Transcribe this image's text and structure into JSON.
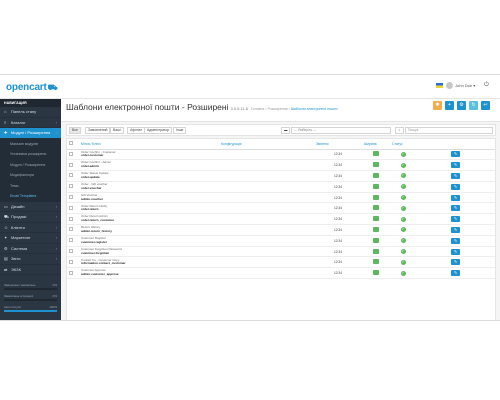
{
  "brand": {
    "logo_text": "opencart",
    "cart_glyph": "⛟"
  },
  "topbar": {
    "user_name": "John Doe",
    "user_menu_glyph": "▾",
    "logout_glyph": "⏻"
  },
  "sidebar": {
    "header": "НАВИГАЦИЯ",
    "items": [
      {
        "label": "Панель стану",
        "icon": "dashboard-icon",
        "glyph": "⌂",
        "arrow": ""
      },
      {
        "label": "Каталог",
        "icon": "catalog-icon",
        "glyph": "≡",
        "arrow": "›"
      },
      {
        "label": "Модулі / Розширення",
        "icon": "extension-icon",
        "glyph": "✚",
        "arrow": "›",
        "active": true
      }
    ],
    "subitems": [
      {
        "label": "Магазин модулів",
        "arrow": ""
      },
      {
        "label": "Установка розширень",
        "arrow": ""
      },
      {
        "label": "Модулі / Розширення",
        "arrow": ""
      },
      {
        "label": "Модифікатори",
        "arrow": ""
      },
      {
        "label": "Теми",
        "arrow": ""
      },
      {
        "label": "Email Templates",
        "arrow": "",
        "active": true
      }
    ],
    "items2": [
      {
        "label": "Дизайн",
        "icon": "design-icon",
        "glyph": "▭",
        "arrow": "›"
      },
      {
        "label": "Продажі",
        "icon": "sales-icon",
        "glyph": "⛟",
        "arrow": "›"
      },
      {
        "label": "Клієнти",
        "icon": "customers-icon",
        "glyph": "☺",
        "arrow": "›"
      },
      {
        "label": "Маркетинг",
        "icon": "marketing-icon",
        "glyph": "✦",
        "arrow": "›"
      },
      {
        "label": "Система",
        "icon": "system-icon",
        "glyph": "⚙",
        "arrow": "›"
      },
      {
        "label": "Звіти",
        "icon": "reports-icon",
        "glyph": "▤",
        "arrow": "›"
      },
      {
        "label": "ЭКЗК",
        "icon": "exchange-icon",
        "glyph": "⇄",
        "arrow": ""
      }
    ],
    "stats": [
      {
        "label": "Завершено замовлень",
        "value": "0%",
        "fill": 0.0
      },
      {
        "label": "Замовлень в процесі",
        "value": "0%",
        "fill": 0.0
      },
      {
        "label": "Інші статуси",
        "value": "100%",
        "fill": 1.0
      }
    ]
  },
  "header": {
    "title": "Шаблони електронної пошти - Розширені",
    "version": "3.0.5.11.6",
    "breadcrumb": [
      "Головна",
      "Розширення"
    ],
    "breadcrumb_current": "Шаблони електронної пошти",
    "buttons": [
      {
        "name": "lightbulb",
        "glyph": "✱",
        "color": "#f0ad4e"
      },
      {
        "name": "add",
        "glyph": "+",
        "color": "#1e91cf"
      },
      {
        "name": "settings",
        "glyph": "⚙",
        "color": "#1e91cf"
      },
      {
        "name": "refresh",
        "glyph": "↻",
        "color": "#5bc0de"
      },
      {
        "name": "back",
        "glyph": "↩",
        "color": "#1e91cf"
      }
    ]
  },
  "filters": {
    "groups": [
      "Все",
      "Замовлений",
      "Ваші",
      "Афіліат",
      "Адміністратор",
      "Інше"
    ],
    "select_placeholder": "--- Виберіть ---",
    "search_placeholder": "Пошук",
    "folder_glyph": "▬",
    "search_glyph": "⌕"
  },
  "table": {
    "columns": [
      "Мітка / Ключ",
      "Конфігурація",
      "Змінено",
      "Ширина",
      "Статус"
    ],
    "rows": [
      {
        "label": "Order Confirm - Customer",
        "key": "order.customer",
        "date": "12:34"
      },
      {
        "label": "Order Confirm - Admin",
        "key": "order.admin",
        "date": "12:34"
      },
      {
        "label": "Order Status Update",
        "key": "order.update",
        "date": "12:34"
      },
      {
        "label": "Order - Gift voucher",
        "key": "order.voucher",
        "date": "12:34"
      },
      {
        "label": "Gift Voucher",
        "key": "admin.voucher",
        "date": "12:34"
      },
      {
        "label": "Order Return Notify",
        "key": "order.return",
        "date": "12:34"
      },
      {
        "label": "Order Return Admin",
        "key": "order.return_customer",
        "date": "12:34"
      },
      {
        "label": "Return History",
        "key": "admin.return_history",
        "date": "12:34"
      },
      {
        "label": "Customer Register",
        "key": "customer.register",
        "date": "12:34"
      },
      {
        "label": "Customer Forgotten Password",
        "key": "customer.forgotten",
        "date": "12:34"
      },
      {
        "label": "Contact Us - Customer Copy",
        "key": "information.contact_customer",
        "date": "12:34"
      },
      {
        "label": "Customer Approve",
        "key": "admin.customer_approve",
        "date": "12:34"
      }
    ],
    "status_glyph": "✓",
    "edit_glyph": "✎"
  }
}
